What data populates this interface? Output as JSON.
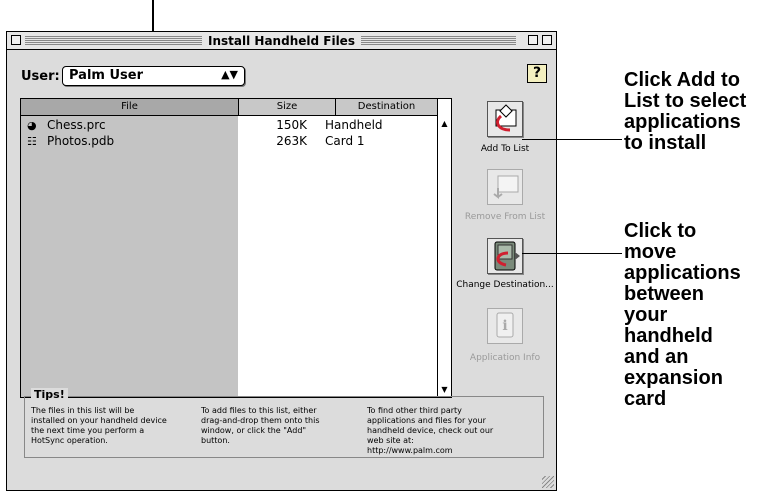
{
  "window": {
    "title": "Install Handheld Files"
  },
  "user": {
    "label": "User:",
    "selected": "Palm User",
    "popup_arrows": "⬍"
  },
  "help": {
    "label": "?"
  },
  "table": {
    "columns": [
      "File",
      "Size",
      "Destination"
    ],
    "rows": [
      {
        "icon": "app-icon",
        "name": "Chess.prc",
        "size": "150K",
        "destination": "Handheld"
      },
      {
        "icon": "document-icon",
        "name": "Photos.pdb",
        "size": "263K",
        "destination": "Card 1"
      }
    ]
  },
  "buttons": {
    "add": {
      "label": "Add To List",
      "enabled": true
    },
    "remove": {
      "label": "Remove From List",
      "enabled": false
    },
    "change": {
      "label": "Change Destination...",
      "enabled": true
    },
    "info": {
      "label": "Application Info",
      "enabled": false
    }
  },
  "tips": {
    "title": "Tips!",
    "tip1": "The files in this list will be\ninstalled on your handheld device\nthe next time you perform a\nHotSync operation.",
    "tip2": "To add files to this list, either\ndrag-and-drop them onto this\nwindow, or click the \"Add\"\nbutton.",
    "tip3": "To find other third party\napplications and files for your\nhandheld device, check out our\nweb site at:\nhttp://www.palm.com"
  },
  "callouts": {
    "add": "Click Add to\nList to select\napplications\nto install",
    "move": "Click to\nmove\napplications\nbetween\nyour\nhandheld\nand an\nexpansion\ncard"
  },
  "colors": {
    "accent_red": "#d02030",
    "window_bg": "#dcdcdc",
    "selected_column": "#c4c4c4"
  }
}
